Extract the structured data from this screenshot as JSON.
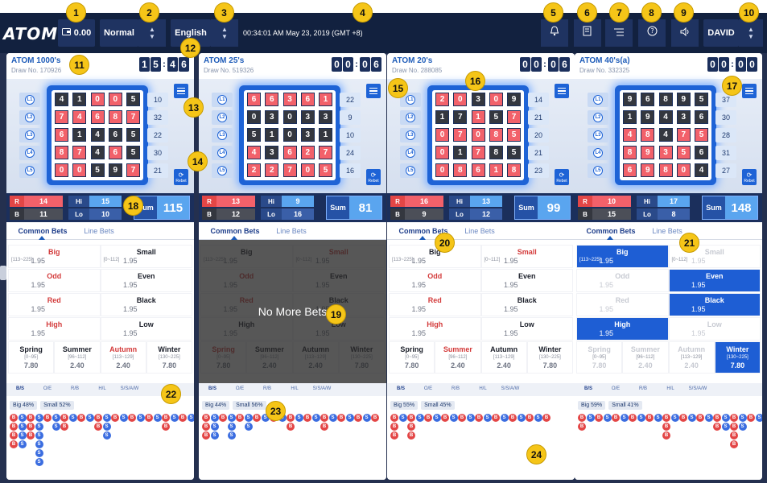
{
  "app": {
    "logo": "ATOM",
    "balance": "0.00",
    "mode": "Normal",
    "language": "English",
    "datetime": "00:34:01 AM May 23, 2019 (GMT +8)",
    "user": "DAVID"
  },
  "header_icons": [
    "bell-icon",
    "notes-icon",
    "list-icon",
    "help-icon",
    "sound-icon"
  ],
  "markers": [
    "1",
    "2",
    "3",
    "4",
    "5",
    "6",
    "7",
    "8",
    "9",
    "10",
    "11",
    "12",
    "13",
    "14",
    "15",
    "16",
    "17",
    "18",
    "19",
    "20",
    "21",
    "22",
    "23",
    "24"
  ],
  "colors": {
    "accent": "#1e63d6",
    "red": "#f2616a",
    "black": "#34373f",
    "navy": "#12213f"
  },
  "panels": [
    {
      "title": "ATOM 1000's",
      "draw": "Draw No. 170926",
      "timer": [
        "1",
        "5",
        "4",
        "6"
      ],
      "grid": [
        [
          [
            "4",
            "b"
          ],
          [
            "1",
            "b"
          ],
          [
            "0",
            "r"
          ],
          [
            "0",
            "r"
          ],
          [
            "5",
            "b"
          ]
        ],
        [
          [
            "7",
            "r"
          ],
          [
            "4",
            "r"
          ],
          [
            "6",
            "r"
          ],
          [
            "8",
            "r"
          ],
          [
            "7",
            "r"
          ]
        ],
        [
          [
            "6",
            "r"
          ],
          [
            "1",
            "b"
          ],
          [
            "4",
            "b"
          ],
          [
            "6",
            "b"
          ],
          [
            "5",
            "b"
          ]
        ],
        [
          [
            "8",
            "r"
          ],
          [
            "7",
            "r"
          ],
          [
            "4",
            "b"
          ],
          [
            "6",
            "r"
          ],
          [
            "5",
            "b"
          ]
        ],
        [
          [
            "0",
            "r"
          ],
          [
            "0",
            "r"
          ],
          [
            "5",
            "b"
          ],
          [
            "9",
            "b"
          ],
          [
            "7",
            "r"
          ]
        ]
      ],
      "row_labels": [
        "L1",
        "L2",
        "L3",
        "L4",
        "L5"
      ],
      "row_sums": [
        "10",
        "32",
        "22",
        "30",
        "21"
      ],
      "stats": {
        "r_label": "R",
        "r": "14",
        "b_label": "B",
        "b": "11",
        "hi_label": "Hi",
        "hi": "15",
        "lo_label": "Lo",
        "lo": "10",
        "sum_label": "Sum",
        "sum": "115"
      },
      "tabs": [
        "Common Bets",
        "Line Bets"
      ],
      "bets": [
        [
          {
            "n": "Big",
            "c": "red",
            "r": "[113~225]",
            "o": "1.95"
          },
          {
            "n": "Small",
            "c": "dark",
            "r": "[0~112]",
            "o": "1.95"
          }
        ],
        [
          {
            "n": "Odd",
            "c": "red",
            "r": "",
            "o": "1.95"
          },
          {
            "n": "Even",
            "c": "dark",
            "r": "",
            "o": "1.95"
          }
        ],
        [
          {
            "n": "Red",
            "c": "red",
            "r": "",
            "o": "1.95"
          },
          {
            "n": "Black",
            "c": "dark",
            "r": "",
            "o": "1.95"
          }
        ],
        [
          {
            "n": "High",
            "c": "red",
            "r": "",
            "o": "1.95"
          },
          {
            "n": "Low",
            "c": "dark",
            "r": "",
            "o": "1.95"
          }
        ]
      ],
      "seasons": [
        {
          "n": "Spring",
          "c": "dark",
          "r": "[0~95]",
          "o": "7.80"
        },
        {
          "n": "Summer",
          "c": "dark",
          "r": "[96~112]",
          "o": "2.40"
        },
        {
          "n": "Autumn",
          "c": "red",
          "r": "[113~129]",
          "o": "2.40"
        },
        {
          "n": "Winter",
          "c": "dark",
          "r": "[130~225]",
          "o": "7.80"
        }
      ],
      "road_tabs": [
        "B/S",
        "O/E",
        "R/B",
        "H/L",
        "S/S/A/W"
      ],
      "road_pct": [
        "Big 48%",
        "Small 52%"
      ],
      "road_cols": [
        "BBBB",
        "SSSS",
        "BBB",
        "SSSSSS",
        "B",
        "SS",
        "BB",
        "S",
        "B",
        "S",
        "BB",
        "SSS",
        "B",
        "S",
        "B",
        "S",
        "B",
        "S",
        "BB",
        "S",
        "B",
        "S"
      ],
      "overlay": ""
    },
    {
      "title": "ATOM 25's",
      "draw": "Draw No. 519326",
      "timer": [
        "0",
        "0",
        "0",
        "6"
      ],
      "grid": [
        [
          [
            "6",
            "r"
          ],
          [
            "6",
            "r"
          ],
          [
            "3",
            "r"
          ],
          [
            "6",
            "r"
          ],
          [
            "1",
            "r"
          ]
        ],
        [
          [
            "0",
            "b"
          ],
          [
            "3",
            "b"
          ],
          [
            "0",
            "b"
          ],
          [
            "3",
            "b"
          ],
          [
            "3",
            "b"
          ]
        ],
        [
          [
            "5",
            "b"
          ],
          [
            "1",
            "b"
          ],
          [
            "0",
            "b"
          ],
          [
            "3",
            "b"
          ],
          [
            "1",
            "b"
          ]
        ],
        [
          [
            "4",
            "r"
          ],
          [
            "3",
            "b"
          ],
          [
            "6",
            "r"
          ],
          [
            "2",
            "r"
          ],
          [
            "7",
            "r"
          ]
        ],
        [
          [
            "2",
            "r"
          ],
          [
            "2",
            "r"
          ],
          [
            "7",
            "r"
          ],
          [
            "0",
            "r"
          ],
          [
            "5",
            "r"
          ]
        ]
      ],
      "row_labels": [
        "L1",
        "L2",
        "L3",
        "L4",
        "L5"
      ],
      "row_sums": [
        "22",
        "9",
        "10",
        "24",
        "16"
      ],
      "stats": {
        "r_label": "R",
        "r": "13",
        "b_label": "B",
        "b": "12",
        "hi_label": "Hi",
        "hi": "9",
        "lo_label": "Lo",
        "lo": "16",
        "sum_label": "Sum",
        "sum": "81"
      },
      "tabs": [
        "Common Bets",
        "Line Bets"
      ],
      "bets": [
        [
          {
            "n": "Big",
            "c": "dark",
            "r": "[113~225]",
            "o": "1.95"
          },
          {
            "n": "Small",
            "c": "red",
            "r": "[0~112]",
            "o": "1.95"
          }
        ],
        [
          {
            "n": "Odd",
            "c": "red",
            "r": "",
            "o": "1.95"
          },
          {
            "n": "Even",
            "c": "dark",
            "r": "",
            "o": "1.95"
          }
        ],
        [
          {
            "n": "Red",
            "c": "red",
            "r": "",
            "o": "1.95"
          },
          {
            "n": "Black",
            "c": "dark",
            "r": "",
            "o": "1.95"
          }
        ],
        [
          {
            "n": "High",
            "c": "dark",
            "r": "",
            "o": "1.95"
          },
          {
            "n": "Low",
            "c": "dark",
            "r": "",
            "o": "1.95"
          }
        ]
      ],
      "seasons": [
        {
          "n": "Spring",
          "c": "red",
          "r": "[0~95]",
          "o": "7.80"
        },
        {
          "n": "Summer",
          "c": "dark",
          "r": "[96~112]",
          "o": "2.40"
        },
        {
          "n": "Autumn",
          "c": "dark",
          "r": "[113~129]",
          "o": "2.40"
        },
        {
          "n": "Winter",
          "c": "dark",
          "r": "[130~225]",
          "o": "7.80"
        }
      ],
      "road_tabs": [
        "B/S",
        "O/E",
        "R/B",
        "H/L",
        "S/S/A/W"
      ],
      "road_pct": [
        "Big 44%",
        "Small 56%"
      ],
      "road_cols": [
        "BBB",
        "SSS",
        "B",
        "SSS",
        "B",
        "SS",
        "B",
        "S",
        "B",
        "S",
        "BB",
        "S",
        "B",
        "S",
        "BB",
        "S",
        "B",
        "S",
        "B",
        "S",
        "B"
      ],
      "overlay": "No More Bets"
    },
    {
      "title": "ATOM 20's",
      "draw": "Draw No. 288085",
      "timer": [
        "0",
        "0",
        "0",
        "6"
      ],
      "grid": [
        [
          [
            "2",
            "r"
          ],
          [
            "0",
            "r"
          ],
          [
            "3",
            "b"
          ],
          [
            "0",
            "r"
          ],
          [
            "9",
            "b"
          ]
        ],
        [
          [
            "1",
            "b"
          ],
          [
            "7",
            "b"
          ],
          [
            "1",
            "r"
          ],
          [
            "5",
            "b"
          ],
          [
            "7",
            "r"
          ]
        ],
        [
          [
            "0",
            "r"
          ],
          [
            "7",
            "r"
          ],
          [
            "0",
            "r"
          ],
          [
            "8",
            "r"
          ],
          [
            "5",
            "r"
          ]
        ],
        [
          [
            "0",
            "r"
          ],
          [
            "1",
            "b"
          ],
          [
            "7",
            "r"
          ],
          [
            "8",
            "b"
          ],
          [
            "5",
            "b"
          ]
        ],
        [
          [
            "0",
            "r"
          ],
          [
            "8",
            "r"
          ],
          [
            "6",
            "r"
          ],
          [
            "1",
            "r"
          ],
          [
            "8",
            "r"
          ]
        ]
      ],
      "row_labels": [
        "L1",
        "L2",
        "L3",
        "L4",
        "L5"
      ],
      "row_sums": [
        "14",
        "21",
        "20",
        "21",
        "23"
      ],
      "stats": {
        "r_label": "R",
        "r": "16",
        "b_label": "B",
        "b": "9",
        "hi_label": "Hi",
        "hi": "13",
        "lo_label": "Lo",
        "lo": "12",
        "sum_label": "Sum",
        "sum": "99"
      },
      "tabs": [
        "Common Bets",
        "Line Bets"
      ],
      "bets": [
        [
          {
            "n": "Big",
            "c": "dark",
            "r": "[113~225]",
            "o": "1.95"
          },
          {
            "n": "Small",
            "c": "red",
            "r": "[0~112]",
            "o": "1.95"
          }
        ],
        [
          {
            "n": "Odd",
            "c": "red",
            "r": "",
            "o": "1.95"
          },
          {
            "n": "Even",
            "c": "dark",
            "r": "",
            "o": "1.95"
          }
        ],
        [
          {
            "n": "Red",
            "c": "red",
            "r": "",
            "o": "1.95"
          },
          {
            "n": "Black",
            "c": "dark",
            "r": "",
            "o": "1.95"
          }
        ],
        [
          {
            "n": "High",
            "c": "red",
            "r": "",
            "o": "1.95"
          },
          {
            "n": "Low",
            "c": "dark",
            "r": "",
            "o": "1.95"
          }
        ]
      ],
      "seasons": [
        {
          "n": "Spring",
          "c": "dark",
          "r": "[0~95]",
          "o": "7.80"
        },
        {
          "n": "Summer",
          "c": "red",
          "r": "[96~112]",
          "o": "2.40"
        },
        {
          "n": "Autumn",
          "c": "dark",
          "r": "[113~129]",
          "o": "2.40"
        },
        {
          "n": "Winter",
          "c": "dark",
          "r": "[130~225]",
          "o": "7.80"
        }
      ],
      "road_tabs": [
        "B/S",
        "O/E",
        "R/B",
        "H/L",
        "S/S/A/W"
      ],
      "road_pct": [
        "Big 55%",
        "Small 45%"
      ],
      "road_cols": [
        "BBB",
        "S",
        "BBB",
        "S",
        "B",
        "S",
        "B",
        "S",
        "B",
        "S",
        "B",
        "S",
        "B",
        "S",
        "B",
        "S",
        "B",
        "S",
        "B"
      ],
      "overlay": ""
    },
    {
      "title": "ATOM 40's(a)",
      "draw": "Draw No. 332325",
      "timer": [
        "0",
        "0",
        "0",
        "0"
      ],
      "grid": [
        [
          [
            "9",
            "b"
          ],
          [
            "6",
            "b"
          ],
          [
            "8",
            "b"
          ],
          [
            "9",
            "b"
          ],
          [
            "5",
            "b"
          ]
        ],
        [
          [
            "1",
            "b"
          ],
          [
            "9",
            "b"
          ],
          [
            "4",
            "b"
          ],
          [
            "3",
            "b"
          ],
          [
            "6",
            "b"
          ]
        ],
        [
          [
            "4",
            "r"
          ],
          [
            "8",
            "r"
          ],
          [
            "4",
            "b"
          ],
          [
            "7",
            "r"
          ],
          [
            "5",
            "r"
          ]
        ],
        [
          [
            "8",
            "r"
          ],
          [
            "9",
            "r"
          ],
          [
            "3",
            "r"
          ],
          [
            "5",
            "r"
          ],
          [
            "6",
            "b"
          ]
        ],
        [
          [
            "6",
            "r"
          ],
          [
            "9",
            "r"
          ],
          [
            "8",
            "r"
          ],
          [
            "0",
            "r"
          ],
          [
            "4",
            "b"
          ]
        ]
      ],
      "row_labels": [
        "L1",
        "L2",
        "L3",
        "L4",
        "L5"
      ],
      "row_sums": [
        "37",
        "30",
        "28",
        "31",
        "27"
      ],
      "stats": {
        "r_label": "R",
        "r": "10",
        "b_label": "B",
        "b": "15",
        "hi_label": "Hi",
        "hi": "17",
        "lo_label": "Lo",
        "lo": "8",
        "sum_label": "Sum",
        "sum": "148"
      },
      "tabs": [
        "Common Bets",
        "Line Bets"
      ],
      "bets": [
        [
          {
            "n": "Big",
            "c": "sel",
            "r": "[113~225]",
            "o": "1.95"
          },
          {
            "n": "Small",
            "c": "dim",
            "r": "[0~112]",
            "o": "1.95"
          }
        ],
        [
          {
            "n": "Odd",
            "c": "dim",
            "r": "",
            "o": "1.95"
          },
          {
            "n": "Even",
            "c": "sel",
            "r": "",
            "o": "1.95"
          }
        ],
        [
          {
            "n": "Red",
            "c": "dim",
            "r": "",
            "o": "1.95"
          },
          {
            "n": "Black",
            "c": "sel",
            "r": "",
            "o": "1.95"
          }
        ],
        [
          {
            "n": "High",
            "c": "sel",
            "r": "",
            "o": "1.95"
          },
          {
            "n": "Low",
            "c": "dim",
            "r": "",
            "o": "1.95"
          }
        ]
      ],
      "seasons": [
        {
          "n": "Spring",
          "c": "dim",
          "r": "[0~95]",
          "o": "7.80"
        },
        {
          "n": "Summer",
          "c": "dim",
          "r": "[96~112]",
          "o": "2.40"
        },
        {
          "n": "Autumn",
          "c": "dim",
          "r": "[113~129]",
          "o": "2.40"
        },
        {
          "n": "Winter",
          "c": "sel",
          "r": "[130~225]",
          "o": "7.80"
        }
      ],
      "road_tabs": [
        "B/S",
        "O/E",
        "R/B",
        "H/L",
        "S/S/A/W"
      ],
      "road_pct": [
        "Big 59%",
        "Small 41%"
      ],
      "road_cols": [
        "BB",
        "S",
        "B",
        "S",
        "B",
        "S",
        "B",
        "S",
        "B",
        "S",
        "BBB",
        "S",
        "B",
        "S",
        "B",
        "S",
        "BB",
        "SS",
        "BBBB",
        "SS",
        "B",
        "S"
      ],
      "overlay": ""
    }
  ]
}
